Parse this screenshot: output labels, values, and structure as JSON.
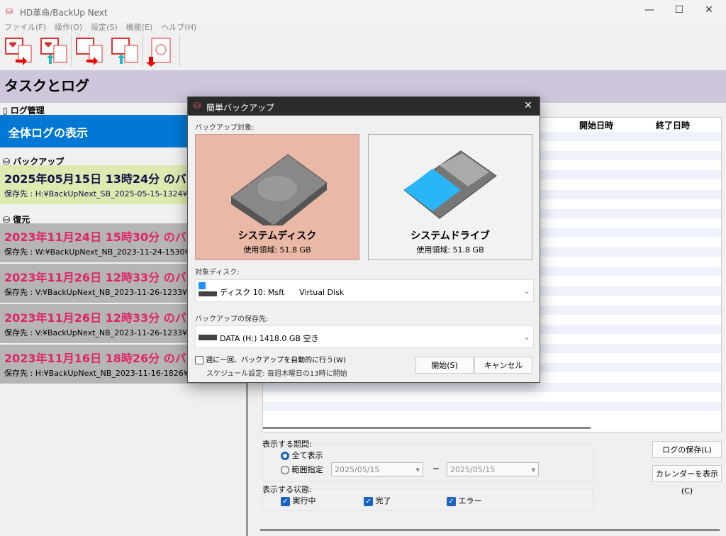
{
  "window": {
    "title": "HD革命/BackUp Next",
    "min": "—",
    "max": "☐",
    "close": "✕"
  },
  "menu": [
    "ファイル(F)",
    "操作(O)",
    "設定(S)",
    "機能(E)",
    "ヘルプ(H)"
  ],
  "header": {
    "title": "タスクとログ"
  },
  "left": {
    "log_section": "ログ管理",
    "all_logs": "全体ログの表示",
    "backup_section": "バックアップ",
    "backups": [
      {
        "title": "2025年05月15日 13時24分 のバックアップ",
        "path": "保存先 : H:¥BackUpNext_SB_2025-05-15-1324¥"
      }
    ],
    "restore_section": "復元",
    "restores": [
      {
        "title": "2023年11月24日 15時30分 のバックアップ",
        "path": "保存先 : W:¥BackUpNext_NB_2023-11-24-1530¥"
      },
      {
        "title": "2023年11月26日 12時33分 のバックアップ",
        "path": "保存先 : V:¥BackUpNext_NB_2023-11-26-1233¥"
      },
      {
        "title": "2023年11月26日 12時33分 のバックアップ",
        "path": "保存先 : V:¥BackUpNext_NB_2023-11-26-1233¥"
      },
      {
        "title": "2023年11月16日 18時26分 のバックアップ",
        "path": "保存先 : H:¥BackUpNext_NB_2023-11-16-1826¥"
      }
    ]
  },
  "table": {
    "columns": [
      "開始日時",
      "終了日時"
    ]
  },
  "filters": {
    "period_label": "表示する期間:",
    "all": "全て表示",
    "range": "範囲指定",
    "from": "2025/05/15",
    "tilde": "~",
    "to": "2025/05/15",
    "state_label": "表示する状態:",
    "running": "実行中",
    "done": "完了",
    "error": "エラー",
    "save_log": "ログの保存(L)",
    "show_calendar": "カレンダーを表示(C)"
  },
  "dialog": {
    "title": "簡単バックアップ",
    "close": "✕",
    "target_label": "バックアップ対象:",
    "cards": [
      {
        "name": "システムディスク",
        "usage": "使用領域: 51.8 GB"
      },
      {
        "name": "システムドライブ",
        "usage": "使用領域: 51.8 GB"
      }
    ],
    "disk_label": "対象ディスク:",
    "disk_value": "ディスク 10: Msft      Virtual Disk",
    "dest_label": "バックアップの保存先:",
    "dest_value": "DATA (H:)  1418.0 GB 空き",
    "weekly": "週に一回、バックアップを自動的に行う(W)",
    "schedule": "スケジュール設定: 毎週木曜日の13時に開始",
    "start": "開始(S)",
    "cancel": "キャンセル"
  },
  "colors": {
    "accent": "#0078d4",
    "backup_bg": "#dcebb0",
    "restore_text": "#e0246a",
    "selected_card": "#eab8a6"
  }
}
